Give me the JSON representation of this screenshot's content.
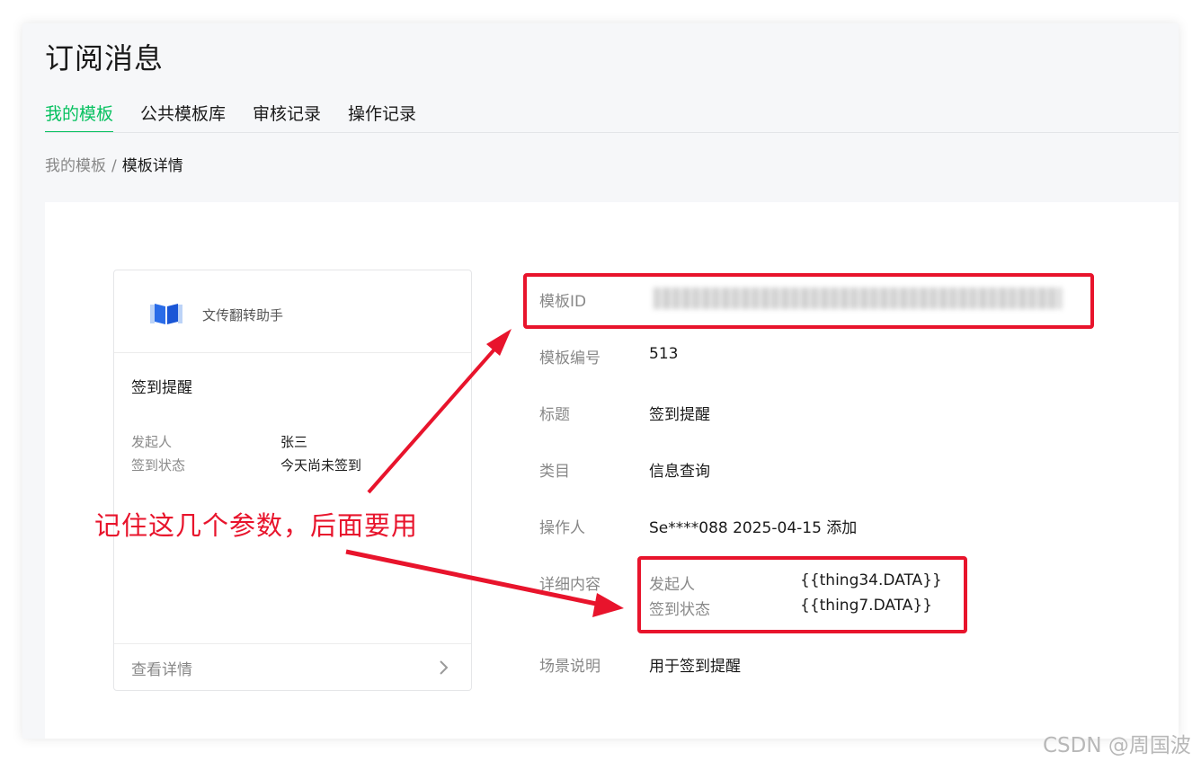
{
  "header": {
    "title": "订阅消息",
    "tabs": [
      {
        "label": "我的模板",
        "active": true
      },
      {
        "label": "公共模板库",
        "active": false
      },
      {
        "label": "审核记录",
        "active": false
      },
      {
        "label": "操作记录",
        "active": false
      }
    ]
  },
  "breadcrumb": {
    "parent": "我的模板",
    "separator": "/",
    "current": "模板详情"
  },
  "preview": {
    "app_name": "文传翻转助手",
    "title": "签到提醒",
    "fields": [
      {
        "key": "发起人",
        "value": "张三"
      },
      {
        "key": "签到状态",
        "value": "今天尚未签到"
      }
    ],
    "footer_label": "查看详情"
  },
  "details": {
    "template_id": {
      "label": "模板ID"
    },
    "template_no": {
      "label": "模板编号",
      "value": "513"
    },
    "title": {
      "label": "标题",
      "value": "签到提醒"
    },
    "category": {
      "label": "类目",
      "value": "信息查询"
    },
    "operator": {
      "label": "操作人",
      "value": "Se****088 2025-04-15 添加"
    },
    "content": {
      "label": "详细内容",
      "items": [
        {
          "key": "发起人",
          "value": "{{thing34.DATA}}"
        },
        {
          "key": "签到状态",
          "value": "{{thing7.DATA}}"
        }
      ]
    },
    "scene": {
      "label": "场景说明",
      "value": "用于签到提醒"
    }
  },
  "annotation": {
    "text": "记住这几个参数，后面要用",
    "color": "#e8142c"
  },
  "watermark": "CSDN @周国波",
  "colors": {
    "accent": "#07c160",
    "highlight": "#e8142c",
    "muted": "#888888"
  }
}
